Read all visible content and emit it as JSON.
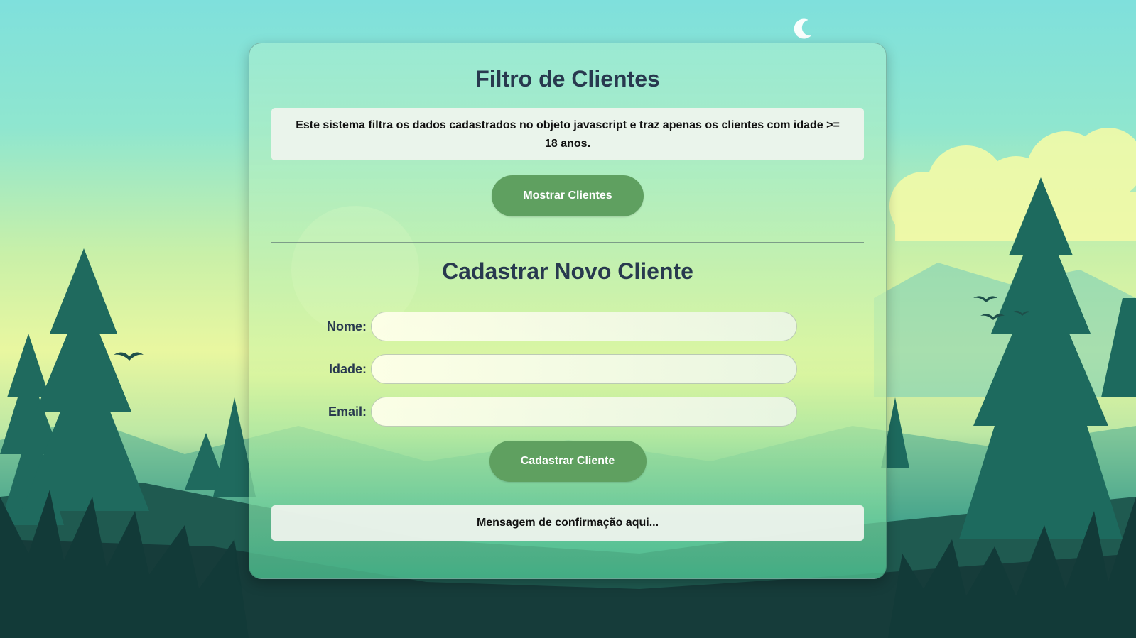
{
  "page": {
    "title": "Filtro de Clientes",
    "description": "Este sistema filtra os dados cadastrados no objeto javascript e traz apenas os clientes com idade >= 18 anos.",
    "show_button": "Mostrar Clientes"
  },
  "register": {
    "title": "Cadastrar Novo Cliente",
    "fields": [
      {
        "label": "Nome:",
        "value": ""
      },
      {
        "label": "Idade:",
        "value": ""
      },
      {
        "label": "Email:",
        "value": ""
      }
    ],
    "submit_button": "Cadastrar Cliente",
    "message": "Mensagem de confirmação aqui..."
  },
  "colors": {
    "button": "#5fa060",
    "heading": "#28394f",
    "box": "#eef2ec"
  }
}
